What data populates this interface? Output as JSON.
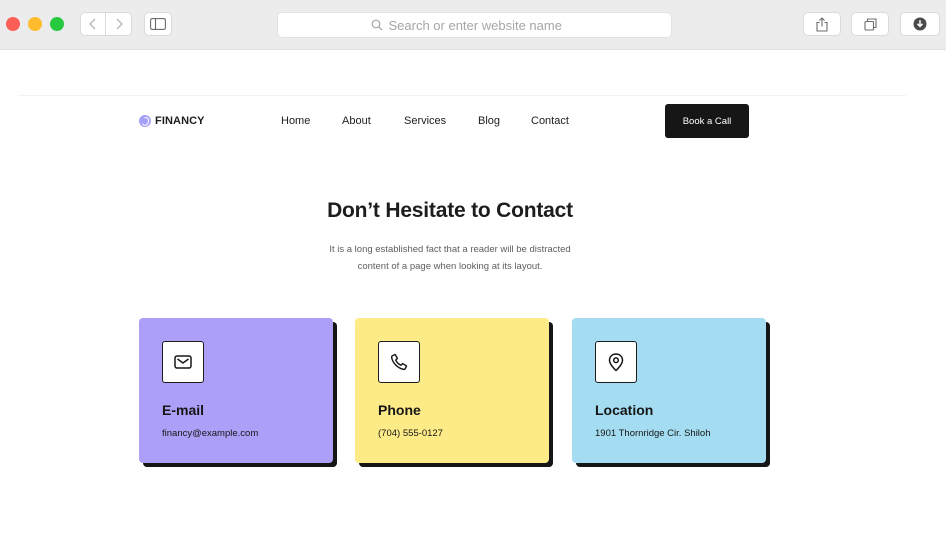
{
  "browser": {
    "search_placeholder": "Search or enter website name",
    "icons": [
      "back-icon",
      "forward-icon",
      "sidebar-icon",
      "search-icon",
      "share-icon",
      "tabs-icon",
      "download-icon"
    ]
  },
  "header": {
    "logo": "FINANCY",
    "nav": [
      "Home",
      "About",
      "Services",
      "Blog",
      "Contact"
    ],
    "cta": "Book a Call"
  },
  "hero": {
    "title": "Don’t Hesitate to Contact",
    "text_line1": "It is a long established fact that a reader will be distracted",
    "text_line2": "content of a page when looking at its layout."
  },
  "cards": [
    {
      "title": "E-mail",
      "value": "financy@example.com",
      "icon": "mail-icon",
      "color": "#ac9ff7"
    },
    {
      "title": "Phone",
      "value": "(704) 555-0127",
      "icon": "phone-icon",
      "color": "#fdeb88"
    },
    {
      "title": "Location",
      "value": "1901 Thornridge Cir. Shiloh",
      "icon": "map-pin-icon",
      "color": "#a4ddf1"
    }
  ]
}
